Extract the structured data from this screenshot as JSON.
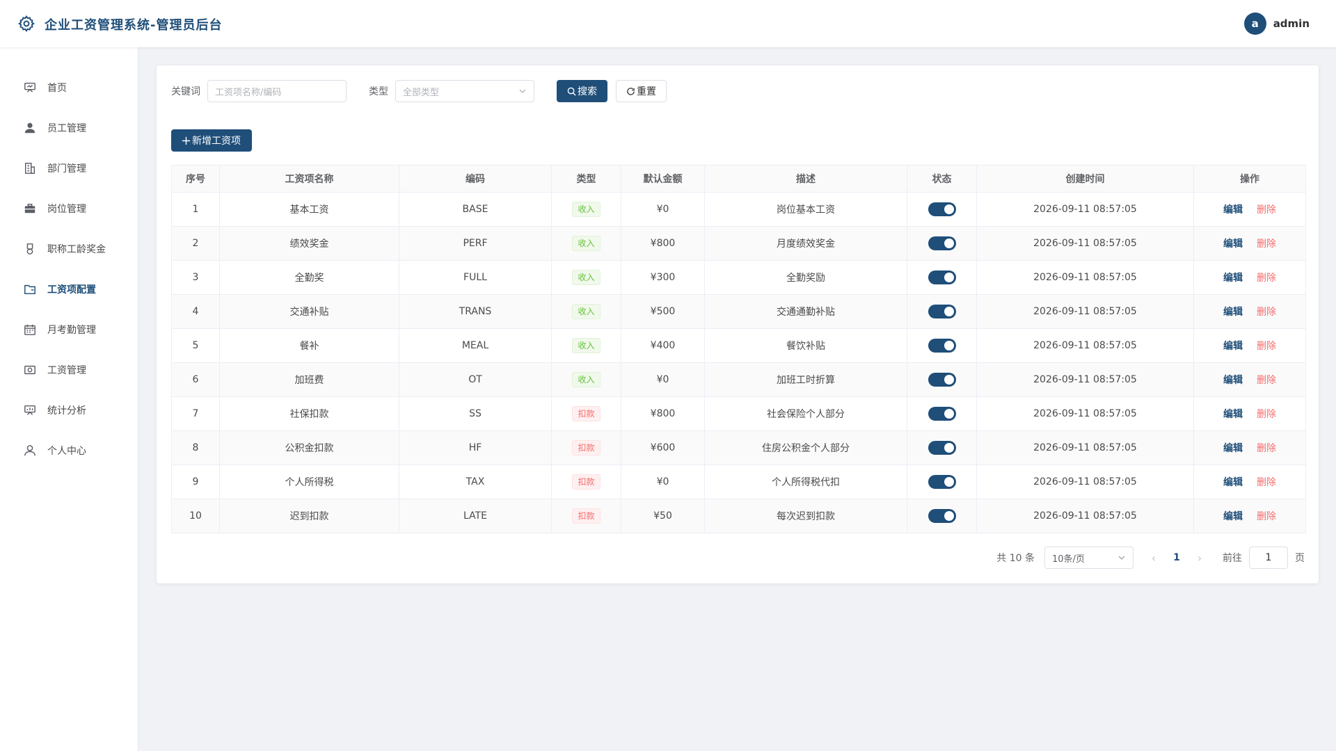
{
  "header": {
    "title": "企业工资管理系统-管理员后台",
    "avatar_letter": "a",
    "username": "admin"
  },
  "sidebar": {
    "items": [
      {
        "label": "首页",
        "icon": "dashboard-icon"
      },
      {
        "label": "员工管理",
        "icon": "user-icon"
      },
      {
        "label": "部门管理",
        "icon": "building-icon"
      },
      {
        "label": "岗位管理",
        "icon": "briefcase-icon"
      },
      {
        "label": "职称工龄奖金",
        "icon": "medal-icon"
      },
      {
        "label": "工资项配置",
        "icon": "folder-icon",
        "active": true
      },
      {
        "label": "月考勤管理",
        "icon": "calendar-icon"
      },
      {
        "label": "工资管理",
        "icon": "money-icon"
      },
      {
        "label": "统计分析",
        "icon": "chart-icon"
      },
      {
        "label": "个人中心",
        "icon": "person-icon"
      }
    ]
  },
  "filter": {
    "keyword_label": "关键词",
    "keyword_placeholder": "工资项名称/编码",
    "type_label": "类型",
    "type_placeholder": "全部类型",
    "search_label": "搜索",
    "reset_label": "重置"
  },
  "add_button": "新增工资项",
  "table": {
    "columns": [
      "序号",
      "工资项名称",
      "编码",
      "类型",
      "默认金额",
      "描述",
      "状态",
      "创建时间",
      "操作"
    ],
    "edit_label": "编辑",
    "delete_label": "删除",
    "rows": [
      {
        "no": "1",
        "name": "基本工资",
        "code": "BASE",
        "type": "收入",
        "amount": "¥0",
        "desc": "岗位基本工资",
        "time": "2026-09-11 08:57:05"
      },
      {
        "no": "2",
        "name": "绩效奖金",
        "code": "PERF",
        "type": "收入",
        "amount": "¥800",
        "desc": "月度绩效奖金",
        "time": "2026-09-11 08:57:05"
      },
      {
        "no": "3",
        "name": "全勤奖",
        "code": "FULL",
        "type": "收入",
        "amount": "¥300",
        "desc": "全勤奖励",
        "time": "2026-09-11 08:57:05"
      },
      {
        "no": "4",
        "name": "交通补贴",
        "code": "TRANS",
        "type": "收入",
        "amount": "¥500",
        "desc": "交通通勤补贴",
        "time": "2026-09-11 08:57:05"
      },
      {
        "no": "5",
        "name": "餐补",
        "code": "MEAL",
        "type": "收入",
        "amount": "¥400",
        "desc": "餐饮补贴",
        "time": "2026-09-11 08:57:05"
      },
      {
        "no": "6",
        "name": "加班费",
        "code": "OT",
        "type": "收入",
        "amount": "¥0",
        "desc": "加班工时折算",
        "time": "2026-09-11 08:57:05"
      },
      {
        "no": "7",
        "name": "社保扣款",
        "code": "SS",
        "type": "扣款",
        "amount": "¥800",
        "desc": "社会保险个人部分",
        "time": "2026-09-11 08:57:05"
      },
      {
        "no": "8",
        "name": "公积金扣款",
        "code": "HF",
        "type": "扣款",
        "amount": "¥600",
        "desc": "住房公积金个人部分",
        "time": "2026-09-11 08:57:05"
      },
      {
        "no": "9",
        "name": "个人所得税",
        "code": "TAX",
        "type": "扣款",
        "amount": "¥0",
        "desc": "个人所得税代扣",
        "time": "2026-09-11 08:57:05"
      },
      {
        "no": "10",
        "name": "迟到扣款",
        "code": "LATE",
        "type": "扣款",
        "amount": "¥50",
        "desc": "每次迟到扣款",
        "time": "2026-09-11 08:57:05"
      }
    ]
  },
  "pagination": {
    "total_text": "共 10 条",
    "page_size": "10条/页",
    "current_page": "1",
    "goto_label": "前往",
    "goto_value": "1",
    "page_suffix": "页"
  },
  "colors": {
    "primary": "#1f4e79",
    "income": "#67c23a",
    "deduct": "#f56c6c"
  }
}
